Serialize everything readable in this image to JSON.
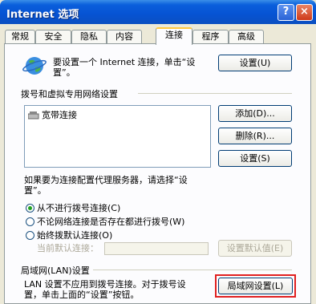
{
  "window": {
    "title": "Internet 选项",
    "help_label": "?",
    "close_label": "×"
  },
  "tabs": [
    {
      "label": "常规"
    },
    {
      "label": "安全"
    },
    {
      "label": "隐私"
    },
    {
      "label": "内容"
    },
    {
      "label": "连接",
      "active": true
    },
    {
      "label": "程序"
    },
    {
      "label": "高级"
    }
  ],
  "setup": {
    "text_line1": "要设置一个 Internet 连接，单击“设",
    "text_line2": "置”。",
    "button": "设置(U)"
  },
  "dialup": {
    "group_label": "拨号和虚拟专用网络设置",
    "connections": [
      {
        "name": "宽带连接"
      }
    ],
    "add_button": "添加(D)...",
    "remove_button": "删除(R)...",
    "settings_button": "设置(S)",
    "proxy_hint_line1": "如果要为连接配置代理服务器，请选择“设",
    "proxy_hint_line2": "置”。",
    "options": [
      {
        "label": "从不进行拨号连接(C)",
        "checked": true
      },
      {
        "label": "不论网络连接是否存在都进行拨号(W)",
        "checked": false
      },
      {
        "label": "始终拨默认连接(O)",
        "checked": false
      }
    ],
    "current_default_label": "当前默认连接：",
    "set_default_button": "设置默认值(E)"
  },
  "lan": {
    "group_label": "局域网(LAN)设置",
    "text_line1": "LAN 设置不应用到拨号连接。对于拨号设",
    "text_line2": "置，单击上面的“设置”按钮。",
    "button": "局域网设置(L)"
  },
  "colors": {
    "titlebar": "#0653d3",
    "highlight": "#e02020",
    "radio_dot": "#21a121"
  }
}
